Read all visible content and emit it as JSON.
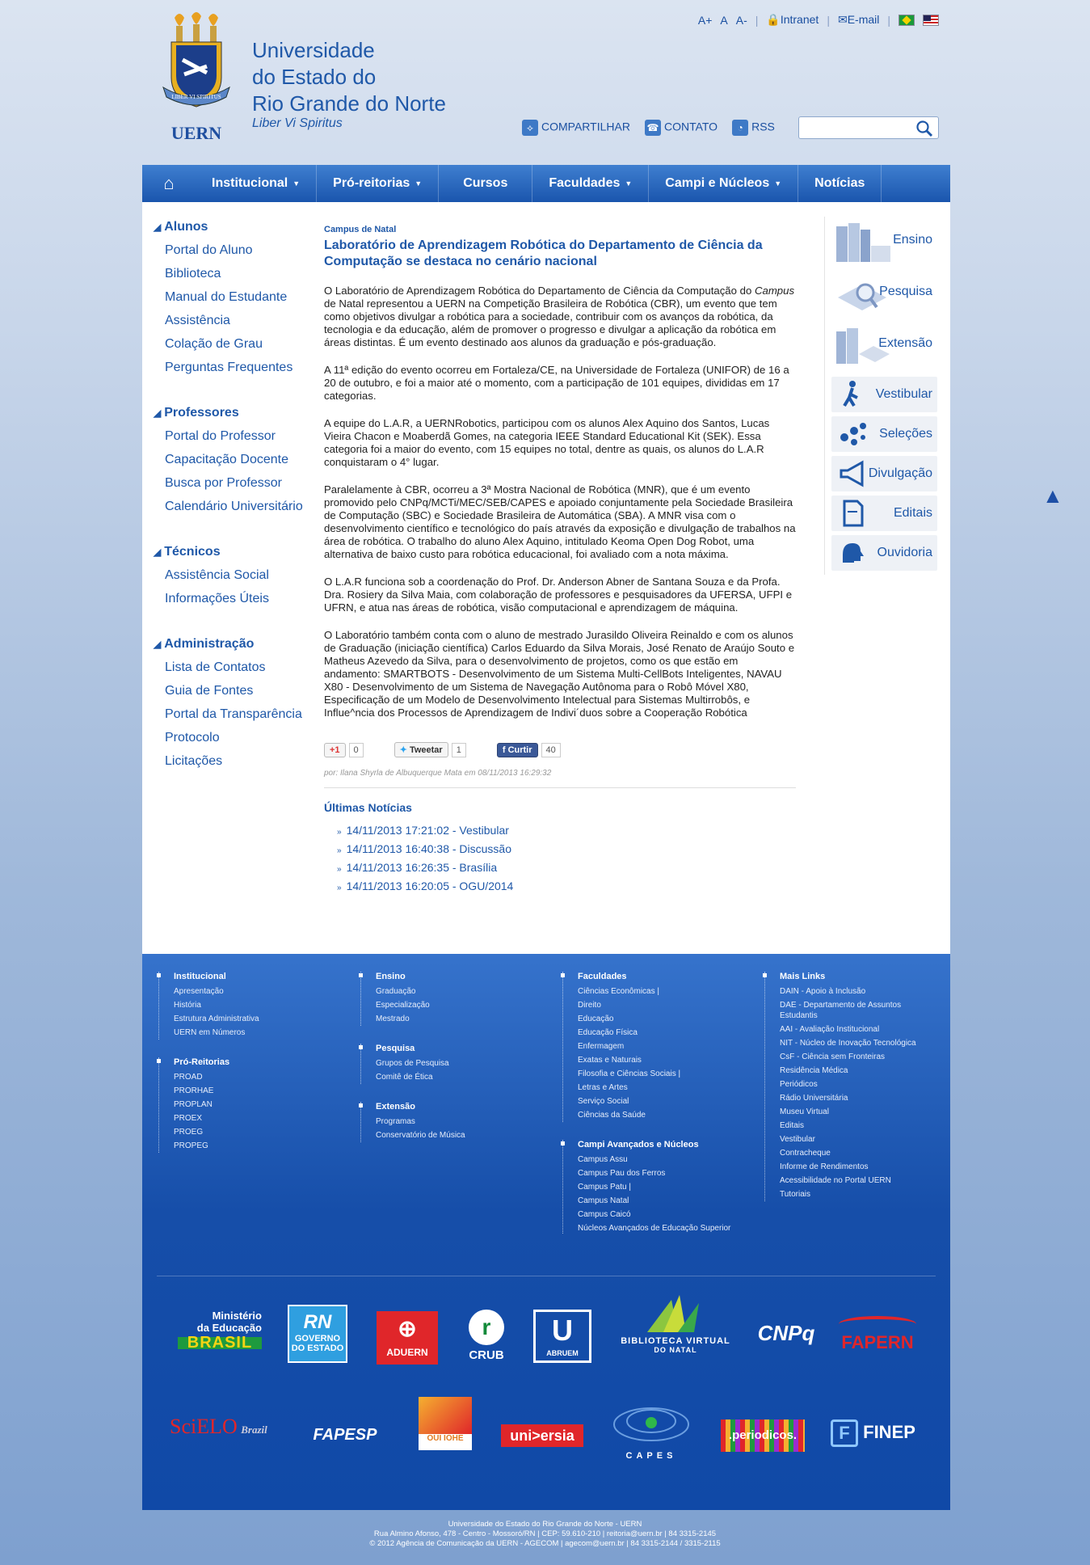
{
  "header": {
    "title_lines": [
      "Universidade",
      "do Estado do",
      "Rio Grande do Norte"
    ],
    "motto": "Liber Vi Spiritus",
    "logo_text": "UERN",
    "logo_ribbon": "LIBER VI SPIRITUS",
    "font_plus": "A+",
    "font_normal": "A",
    "font_minus": "A-",
    "intranet": "Intranet",
    "email": "E-mail",
    "share": "COMPARTILHAR",
    "contact": "CONTATO",
    "rss": "RSS",
    "search_placeholder": ""
  },
  "nav": {
    "items": [
      "Institucional",
      "Pró-reitorias",
      "Cursos",
      "Faculdades",
      "Campi e Núcleos",
      "Notícias"
    ]
  },
  "sidebar": {
    "groups": [
      {
        "title": "Alunos",
        "links": [
          "Portal do Aluno",
          "Biblioteca",
          "Manual do Estudante",
          "Assistência",
          "Colação de Grau",
          "Perguntas Frequentes"
        ]
      },
      {
        "title": "Professores",
        "links": [
          "Portal do Professor",
          "Capacitação Docente",
          "Busca por Professor",
          "Calendário Universitário"
        ]
      },
      {
        "title": "Técnicos",
        "links": [
          "Assistência Social",
          "Informações Úteis"
        ]
      },
      {
        "title": "Administração",
        "links": [
          "Lista de Contatos",
          "Guia de Fontes",
          "Portal da Transparência",
          "Protocolo",
          "Licitações"
        ]
      }
    ]
  },
  "article": {
    "kicker": "Campus de Natal",
    "headline": "Laboratório de Aprendizagem Robótica do Departamento de Ciência da Computação se destaca no cenário nacional",
    "p1_a": "O Laboratório de Aprendizagem Robótica do Departamento de Ciência da Computação do ",
    "p1_em": "Campus",
    "p1_b": " de Natal representou a UERN na Competição Brasileira de Robótica (CBR), um evento que tem como objetivos divulgar a robótica para a sociedade, contribuir com os avanços da robótica, da tecnologia e da educação, além de promover o progresso e divulgar a aplicação da robótica em áreas distintas. É um evento destinado aos alunos da graduação e pós-graduação.",
    "p2": "A 11ª edição do evento ocorreu em Fortaleza/CE, na Universidade de Fortaleza (UNIFOR) de 16 a 20 de outubro, e foi a maior até o momento, com a participação de 101 equipes, divididas em 17 categorias.",
    "p3": "A equipe do L.A.R, a UERNRobotics, participou com os alunos Alex Aquino dos Santos, Lucas Vieira Chacon e Moaberdã Gomes, na categoria IEEE Standard Educational Kit (SEK). Essa categoria foi a maior do evento, com 15 equipes no total, dentre as quais, os alunos do L.A.R conquistaram o 4° lugar.",
    "p4": "Paralelamente à CBR, ocorreu a 3ª Mostra Nacional de Robótica (MNR), que é um evento promovido pelo CNPq/MCTi/MEC/SEB/CAPES e apoiado conjuntamente pela Sociedade Brasileira de Computação (SBC) e Sociedade Brasileira de Automática (SBA). A MNR visa com o desenvolvimento científico e tecnológico do país através da exposição e divulgação de trabalhos na área de robótica. O trabalho do aluno Alex Aquino, intitulado Keoma Open Dog Robot, uma alternativa de baixo custo para robótica educacional, foi avaliado com a nota máxima.",
    "p5": "O L.A.R funciona sob a coordenação do Prof. Dr. Anderson Abner de Santana Souza e da Profa. Dra. Rosiery da Silva Maia, com colaboração de professores e pesquisadores da UFERSA, UFPI e UFRN, e atua nas áreas de robótica, visão computacional e aprendizagem de máquina.",
    "p6": "O Laboratório também conta com o aluno de mestrado Jurasildo Oliveira Reinaldo e com os alunos de Graduação (iniciação científica) Carlos Eduardo da Silva Morais, José Renato de Araújo Souto e Matheus Azevedo da Silva, para o desenvolvimento de projetos, como os que estão em andamento: SMARTBOTS - Desenvolvimento de um Sistema Multi-CellBots Inteligentes, NAVAU X80 - Desenvolvimento de um Sistema de Navegação Autônoma para o Robô Móvel X80, Especificação de um Modelo de Desenvolvimento Intelectual para Sistemas Multirrobôs, e Influe^ncia dos Processos de Aprendizagem de Indivi´duos sobre a Cooperação Robótica",
    "gplus": "+1",
    "gplus_count": "0",
    "tweet": "Tweetar",
    "tweet_count": "1",
    "like": "Curtir",
    "like_count": "40",
    "byline": "por: Ilana Shyrla de Albuquerque Mata em 08/11/2013 16:29:32",
    "latest_title": "Últimas Notícias",
    "latest": [
      "14/11/2013 17:21:02 - Vestibular",
      "14/11/2013 16:40:38 - Discussão",
      "14/11/2013 16:26:35 - Brasília",
      "14/11/2013 16:20:05 - OGU/2014"
    ]
  },
  "rightcol": {
    "big": [
      "Ensino",
      "Pesquisa",
      "Extensão"
    ],
    "small": [
      "Vestibular",
      "Seleções",
      "Divulgação",
      "Editais",
      "Ouvidoria"
    ]
  },
  "footer": {
    "col1": [
      {
        "title": "Institucional",
        "links": [
          "Apresentação",
          "História",
          "Estrutura Administrativa",
          "UERN em Números"
        ]
      },
      {
        "title": "Pró-Reitorias",
        "links": [
          "PROAD",
          "PRORHAE",
          "PROPLAN",
          "PROEX",
          "PROEG",
          "PROPEG"
        ]
      }
    ],
    "col2": [
      {
        "title": "Ensino",
        "links": [
          "Graduação",
          "Especialização",
          "Mestrado"
        ]
      },
      {
        "title": "Pesquisa",
        "links": [
          "Grupos de Pesquisa",
          "Comitê de Ética"
        ]
      },
      {
        "title": "Extensão",
        "links": [
          "Programas",
          "Conservatório de Música"
        ]
      }
    ],
    "col3": [
      {
        "title": "Faculdades",
        "links": [
          "Ciências Econômicas |",
          "Direito",
          "Educação",
          "Educação Física",
          "Enfermagem",
          "Exatas e Naturais",
          "Filosofia e Ciências Sociais |",
          "Letras e Artes",
          "Serviço Social",
          "Ciências da Saúde"
        ]
      },
      {
        "title": "Campi Avançados e Núcleos",
        "links": [
          "Campus Assu",
          "Campus Pau dos Ferros",
          "Campus Patu |",
          "Campus Natal",
          "Campus Caicó",
          "Núcleos Avançados de Educação Superior"
        ]
      }
    ],
    "col4": [
      {
        "title": "Mais Links",
        "links": [
          "DAIN - Apoio à Inclusão",
          "DAE - Departamento de Assuntos Estudantis",
          "AAI - Avaliação Institucional",
          "NIT - Núcleo de Inovação Tecnológica",
          "CsF - Ciência sem Fronteiras",
          "Residência Médica",
          "Periódicos",
          "Rádio Universitária",
          "Museu Virtual",
          "Editais",
          "Vestibular",
          "Contracheque",
          "Informe de Rendimentos",
          "Acessibilidade no Portal UERN",
          "Tutoriais"
        ]
      }
    ],
    "logos": {
      "mec_top": "Ministério",
      "mec_mid": "da Educação",
      "mec_brasil": "BRASIL",
      "rn_top": "RN",
      "rn_bottom": "GOVERNO DO ESTADO",
      "aduern": "ADUERN",
      "crub": "CRUB",
      "abruem": "ABRUEM",
      "bvn_top": "BIBLIOTECA VIRTUAL",
      "bvn_bottom": "DO NATAL",
      "cnpq": "CNPq",
      "fapern": "FAPERN",
      "scielo": "SciELO",
      "scielo_sub": "Brazil",
      "fapesp": "FAPESP",
      "oui": "OUI IOHE",
      "universia": "uni>ersia",
      "capes": "CAPES",
      "periodicos": ".periodicos.",
      "finep": "FINEP"
    }
  },
  "legal": [
    "Universidade do Estado do Rio Grande do Norte - UERN",
    "Rua Almino Afonso, 478 - Centro - Mossoró/RN | CEP: 59.610-210 | reitoria@uern.br | 84 3315-2145",
    "© 2012 Agência de Comunicação da UERN - AGECOM | agecom@uern.br | 84 3315-2144 / 3315-2115"
  ],
  "colors": {
    "brand_blue": "#1f58a8",
    "nav_blue": "#1a55ad",
    "footer_blue": "#164ea9"
  }
}
